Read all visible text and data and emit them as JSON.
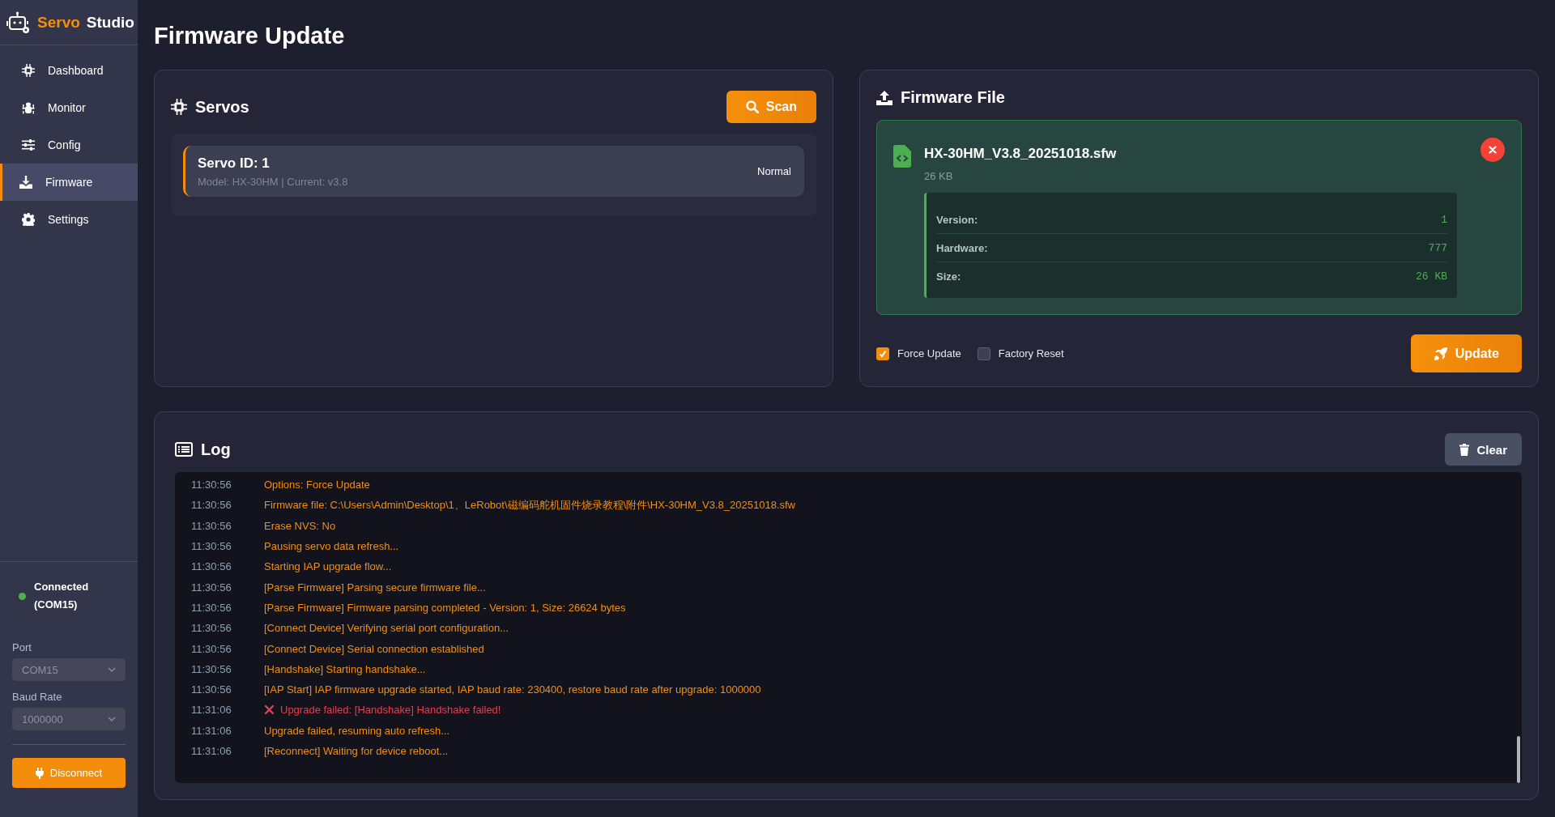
{
  "app": {
    "name_accent": "Servo",
    "name_rest": "Studio"
  },
  "nav": [
    {
      "label": "Dashboard",
      "selected": false
    },
    {
      "label": "Monitor",
      "selected": false
    },
    {
      "label": "Config",
      "selected": false
    },
    {
      "label": "Firmware",
      "selected": true
    },
    {
      "label": "Settings",
      "selected": false
    }
  ],
  "connection": {
    "status": "Connected (COM15)",
    "connected": true
  },
  "port": {
    "label": "Port",
    "value": "COM15"
  },
  "baud_rate": {
    "label": "Baud Rate",
    "value": "1000000"
  },
  "disconnect_button": "Disconnect",
  "page_title": "Firmware Update",
  "servos": {
    "title": "Servos",
    "scan_button": "Scan",
    "items": [
      {
        "title": "Servo ID: 1",
        "details": "Model: HX-30HM | Current: v3.8",
        "status": "Normal",
        "selected": true
      }
    ]
  },
  "firmware_file": {
    "title": "Firmware File",
    "file_name": "HX-30HM_V3.8_20251018.sfw",
    "file_size": "26 KB",
    "details": [
      {
        "label": "Version:",
        "value": "1"
      },
      {
        "label": "Hardware:",
        "value": "777"
      },
      {
        "label": "Size:",
        "value": "26 KB"
      }
    ],
    "options": [
      {
        "label": "Force Update",
        "checked": true
      },
      {
        "label": "Factory Reset",
        "checked": false
      }
    ],
    "update_button": "Update"
  },
  "log": {
    "title": "Log",
    "clear_button": "Clear",
    "entries": [
      {
        "time": "11:30:56",
        "message": "Options: Force Update",
        "kind": "info"
      },
      {
        "time": "11:30:56",
        "message": "Firmware file: C:\\Users\\Admin\\Desktop\\1、LeRobot\\磁编码舵机固件烧录教程\\附件\\HX-30HM_V3.8_20251018.sfw",
        "kind": "info"
      },
      {
        "time": "11:30:56",
        "message": "Erase NVS: No",
        "kind": "info"
      },
      {
        "time": "11:30:56",
        "message": "Pausing servo data refresh...",
        "kind": "info"
      },
      {
        "time": "11:30:56",
        "message": "Starting IAP upgrade flow...",
        "kind": "info"
      },
      {
        "time": "11:30:56",
        "message": "[Parse Firmware] Parsing secure firmware file...",
        "kind": "info"
      },
      {
        "time": "11:30:56",
        "message": "[Parse Firmware] Firmware parsing completed - Version: 1, Size: 26624 bytes",
        "kind": "info"
      },
      {
        "time": "11:30:56",
        "message": "[Connect Device] Verifying serial port configuration...",
        "kind": "info"
      },
      {
        "time": "11:30:56",
        "message": "[Connect Device] Serial connection established",
        "kind": "info"
      },
      {
        "time": "11:30:56",
        "message": "[Handshake] Starting handshake...",
        "kind": "info"
      },
      {
        "time": "11:30:56",
        "message": "[IAP Start] IAP firmware upgrade started, IAP baud rate: 230400, restore baud rate after upgrade: 1000000",
        "kind": "info"
      },
      {
        "time": "11:31:06",
        "message": "Upgrade failed: [Handshake] Handshake failed!",
        "kind": "error"
      },
      {
        "time": "11:31:06",
        "message": "Upgrade failed, resuming auto refresh...",
        "kind": "info"
      },
      {
        "time": "11:31:06",
        "message": "[Reconnect] Waiting for device reboot...",
        "kind": "info"
      }
    ]
  }
}
